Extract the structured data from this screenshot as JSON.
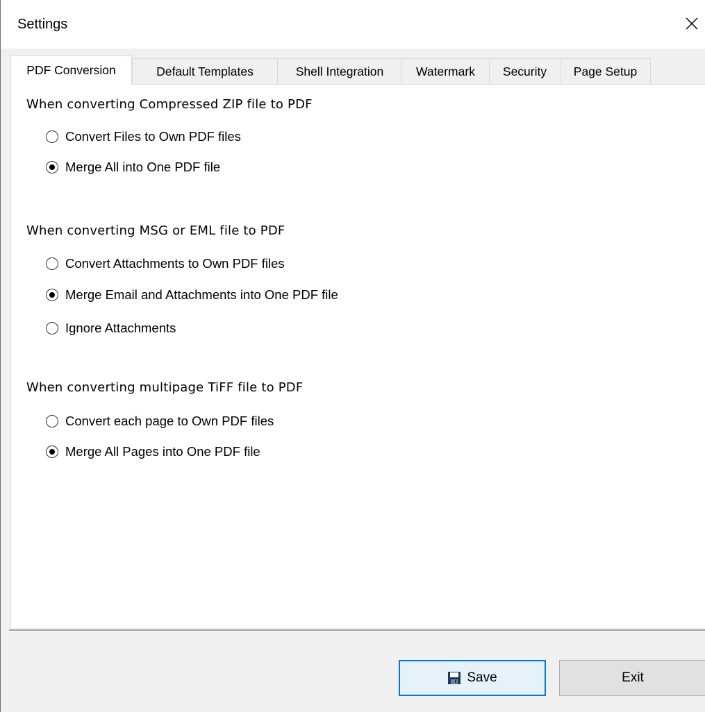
{
  "window": {
    "title": "Settings"
  },
  "tabs": [
    {
      "label": "PDF Conversion",
      "active": true
    },
    {
      "label": "Default Templates",
      "active": false
    },
    {
      "label": "Shell Integration",
      "active": false
    },
    {
      "label": "Watermark",
      "active": false
    },
    {
      "label": "Security",
      "active": false
    },
    {
      "label": "Page Setup",
      "active": false
    }
  ],
  "groups": [
    {
      "title": "When converting Compressed ZIP file to PDF",
      "options": [
        {
          "label": "Convert Files to Own PDF files",
          "checked": false
        },
        {
          "label": "Merge All into One PDF file",
          "checked": true
        }
      ]
    },
    {
      "title": "When converting MSG or EML file to PDF",
      "options": [
        {
          "label": "Convert Attachments to Own PDF files",
          "checked": false
        },
        {
          "label": "Merge Email and Attachments into One PDF file",
          "checked": true
        },
        {
          "label": "Ignore Attachments",
          "checked": false
        }
      ]
    },
    {
      "title": "When converting multipage TiFF file to PDF",
      "options": [
        {
          "label": "Convert each page to Own PDF files",
          "checked": false
        },
        {
          "label": "Merge All Pages into One PDF file",
          "checked": true
        }
      ]
    }
  ],
  "buttons": {
    "save": "Save",
    "exit": "Exit"
  },
  "icons": {
    "close": "close-icon",
    "save": "floppy-disk-icon"
  },
  "colors": {
    "accent": "#0078d7",
    "panel": "#ffffff",
    "chrome": "#f0f0f0"
  }
}
